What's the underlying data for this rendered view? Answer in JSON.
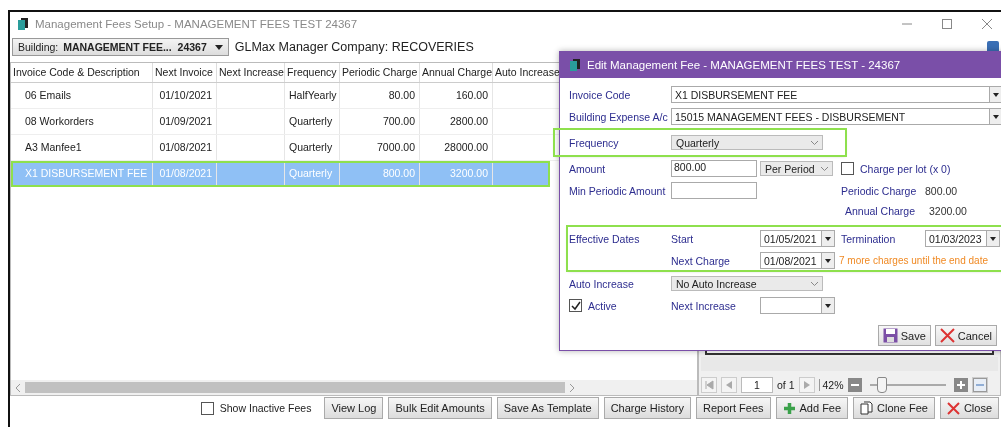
{
  "window": {
    "title": "Management Fees Setup - MANAGEMENT FEES TEST 24367"
  },
  "toolbar": {
    "building_label": "Building:",
    "building_name": "MANAGEMENT FEE...",
    "building_code": "24367",
    "company": "GLMax Manager Company: RECOVERIES"
  },
  "table": {
    "columns": [
      "Invoice Code & Description",
      "Next Invoice",
      "Next Increase",
      "Frequency",
      "Periodic Charge",
      "Annual Charge",
      "Auto Increase"
    ],
    "rows": [
      {
        "selected": false,
        "cells": [
          "06 Emails",
          "01/10/2021",
          "",
          "HalfYearly",
          "80.00",
          "160.00",
          ""
        ]
      },
      {
        "selected": false,
        "cells": [
          "08 Workorders",
          "01/09/2021",
          "",
          "Quarterly",
          "700.00",
          "2800.00",
          ""
        ]
      },
      {
        "selected": false,
        "cells": [
          "A3 Manfee1",
          "01/08/2021",
          "",
          "Quarterly",
          "7000.00",
          "28000.00",
          ""
        ]
      },
      {
        "selected": true,
        "cells": [
          "X1 DISBURSEMENT FEE",
          "01/08/2021",
          "",
          "Quarterly",
          "800.00",
          "3200.00",
          ""
        ]
      }
    ]
  },
  "viewer": {
    "page": "1",
    "page_count": "of 1",
    "zoom": "42%",
    "zoom_slider": {
      "level": 0.15
    }
  },
  "dialog": {
    "title": "Edit Management Fee - MANAGEMENT FEES TEST - 24367",
    "invoice_code": {
      "label": "Invoice Code",
      "value": "X1  DISBURSEMENT FEE"
    },
    "building_expense": {
      "label": "Building Expense A/c",
      "value": "15015  MANAGEMENT FEES - DISBURSEMENT"
    },
    "frequency": {
      "label": "Frequency",
      "value": "Quarterly",
      "highlighted": true
    },
    "amount": {
      "label": "Amount",
      "value": "800.00",
      "basis": "Per Period"
    },
    "charge_per_lot": {
      "label": "Charge per lot (x 0)",
      "checked": false
    },
    "min_periodic_amount": {
      "label": "Min Periodic Amount"
    },
    "periodic_charge": {
      "label": "Periodic Charge",
      "value": "800.00"
    },
    "annual_charge": {
      "label": "Annual Charge",
      "value": "3200.00"
    },
    "effective_dates": {
      "label": "Effective Dates",
      "highlighted": true,
      "start": {
        "label": "Start",
        "value": "01/05/2021"
      },
      "termination": {
        "label": "Termination",
        "value": "01/03/2023"
      },
      "next_charge": {
        "label": "Next Charge",
        "value": "01/08/2021"
      },
      "note": "7 more charges until the end date"
    },
    "auto_increase": {
      "label": "Auto Increase",
      "value": "No Auto Increase"
    },
    "active": {
      "label": "Active",
      "checked": true
    },
    "next_increase": {
      "label": "Next Increase"
    },
    "buttons": [
      {
        "kind": "save",
        "label": "Save"
      },
      {
        "kind": "cancel",
        "label": "Cancel"
      }
    ]
  },
  "footer": {
    "show_inactive": {
      "label": "Show Inactive Fees",
      "checked": false
    },
    "buttons": [
      {
        "kind": "plain",
        "label": "View Log"
      },
      {
        "kind": "plain",
        "label": "Bulk Edit Amounts"
      },
      {
        "kind": "plain",
        "label": "Save As Template"
      },
      {
        "kind": "plain",
        "label": "Charge History"
      },
      {
        "kind": "plain",
        "label": "Report Fees"
      },
      {
        "kind": "add",
        "label": "Add Fee"
      },
      {
        "kind": "clone",
        "label": "Clone Fee"
      },
      {
        "kind": "close",
        "label": "Close"
      }
    ]
  }
}
